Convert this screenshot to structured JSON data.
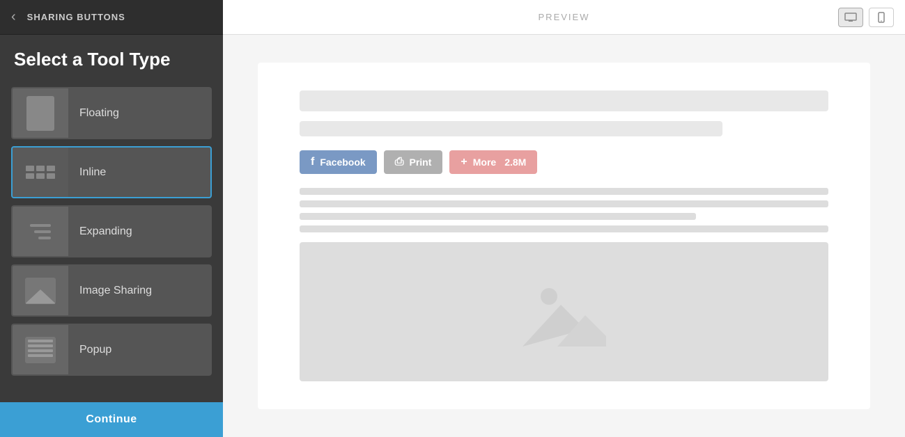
{
  "sidebar": {
    "title": "SHARING BUTTONS",
    "back_label": "‹",
    "heading": "Select a Tool Type",
    "tools": [
      {
        "id": "floating",
        "label": "Floating",
        "selected": false
      },
      {
        "id": "inline",
        "label": "Inline",
        "selected": true
      },
      {
        "id": "expanding",
        "label": "Expanding",
        "selected": false
      },
      {
        "id": "image-sharing",
        "label": "Image Sharing",
        "selected": false
      },
      {
        "id": "popup",
        "label": "Popup",
        "selected": false
      }
    ],
    "continue_label": "Continue"
  },
  "topbar": {
    "preview_label": "PREVIEW"
  },
  "sharing_buttons": {
    "facebook_label": "Facebook",
    "print_label": "Print",
    "more_label": "More",
    "more_count": "2.8M"
  },
  "icons": {
    "back": "‹",
    "desktop": "🖥",
    "mobile": "📱"
  }
}
